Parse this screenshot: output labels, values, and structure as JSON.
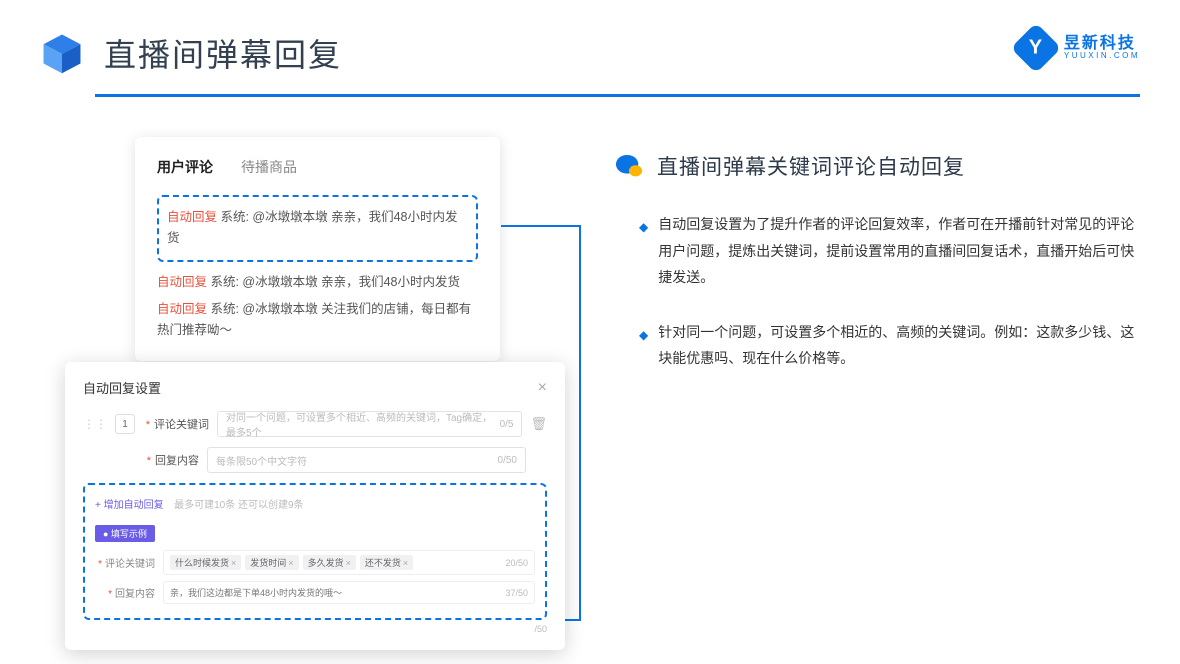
{
  "title": "直播间弹幕回复",
  "brand": {
    "cn": "昱新科技",
    "en": "YUUXIN.COM"
  },
  "panel1": {
    "tabs": {
      "active": "用户评论",
      "inactive": "待播商品"
    },
    "highlighted": {
      "tag": "自动回复",
      "text": " 系统: @冰墩墩本墩 亲亲，我们48小时内发货"
    },
    "lines": [
      {
        "tag": "自动回复",
        "text": " 系统: @冰墩墩本墩 亲亲，我们48小时内发货"
      },
      {
        "tag": "自动回复",
        "text": " 系统: @冰墩墩本墩 关注我们的店铺，每日都有热门推荐呦～"
      }
    ]
  },
  "panel2": {
    "header": "自动回复设置",
    "num": "1",
    "row1": {
      "label": "评论关键词",
      "placeholder": "对同一个问题，可设置多个相近、高频的关键词，Tag确定，最多5个",
      "count": "0/5"
    },
    "row2": {
      "label": "回复内容",
      "placeholder": "每条限50个中文字符",
      "count": "0/50"
    },
    "addlink": "+ 增加自动回复",
    "addhint": "最多可建10条 还可以创建9条",
    "badge": "● 填写示例",
    "ex1": {
      "label": "评论关键词",
      "tags": [
        "什么时候发货",
        "发货时间",
        "多久发货",
        "还不发货"
      ],
      "count": "20/50"
    },
    "ex2": {
      "label": "回复内容",
      "text": "亲，我们这边都是下单48小时内发货的哦～",
      "count": "37/50"
    },
    "bottomcount": "/50"
  },
  "section": {
    "title": "直播间弹幕关键词评论自动回复",
    "b1": "自动回复设置为了提升作者的评论回复效率，作者可在开播前针对常见的评论用户问题，提炼出关键词，提前设置常用的直播间回复话术，直播开始后可快捷发送。",
    "b2": "针对同一个问题，可设置多个相近的、高频的关键词。例如：这款多少钱、这块能优惠吗、现在什么价格等。"
  }
}
